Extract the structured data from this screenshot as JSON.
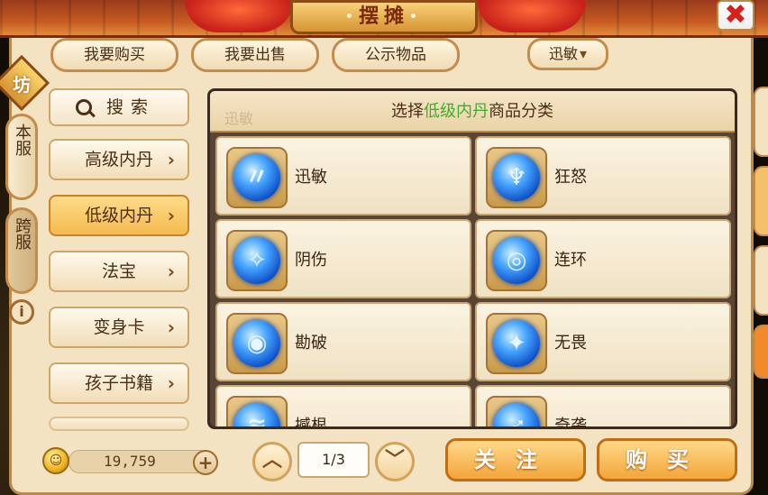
{
  "header": {
    "title": "摆摊",
    "close_label": "✖"
  },
  "top_tabs": [
    {
      "label": "我要购买"
    },
    {
      "label": "我要出售"
    },
    {
      "label": "公示物品"
    }
  ],
  "filter": {
    "label": "迅敏",
    "arrow": "▾"
  },
  "side": {
    "badge": "坊",
    "server_tabs": [
      {
        "label": "本服"
      },
      {
        "label": "跨服"
      }
    ],
    "info": "i"
  },
  "search": {
    "label": "搜索"
  },
  "categories": [
    {
      "label": "高级内丹"
    },
    {
      "label": "低级内丹",
      "active": true
    },
    {
      "label": "法宝"
    },
    {
      "label": "变身卡"
    },
    {
      "label": "孩子书籍"
    }
  ],
  "panel": {
    "title_prefix": "选择",
    "title_highlight": "低级内丹",
    "title_suffix": "商品分类",
    "ghost_left": "迅敏",
    "items": [
      {
        "label": "迅敏",
        "icon": "swift-orb-icon",
        "glyph": "〃"
      },
      {
        "label": "狂怒",
        "icon": "fury-orb-icon",
        "glyph": "♆"
      },
      {
        "label": "阴伤",
        "icon": "shadow-orb-icon",
        "glyph": "✧"
      },
      {
        "label": "连环",
        "icon": "chain-orb-icon",
        "glyph": "◎"
      },
      {
        "label": "勘破",
        "icon": "eye-orb-icon",
        "glyph": "◉"
      },
      {
        "label": "无畏",
        "icon": "fearless-orb-icon",
        "glyph": "✦"
      },
      {
        "label": "撼根",
        "icon": "root-orb-icon",
        "glyph": "≋"
      },
      {
        "label": "奇袭",
        "icon": "raid-orb-icon",
        "glyph": "➶"
      }
    ]
  },
  "footer": {
    "gold": "19,759",
    "plus": "+",
    "page": "1/3",
    "follow_label": "关注",
    "buy_label": "购买"
  },
  "colors": {
    "highlight": "#3dae2b",
    "button_orange": "#f3a53a",
    "frame": "#f4e3c2"
  }
}
